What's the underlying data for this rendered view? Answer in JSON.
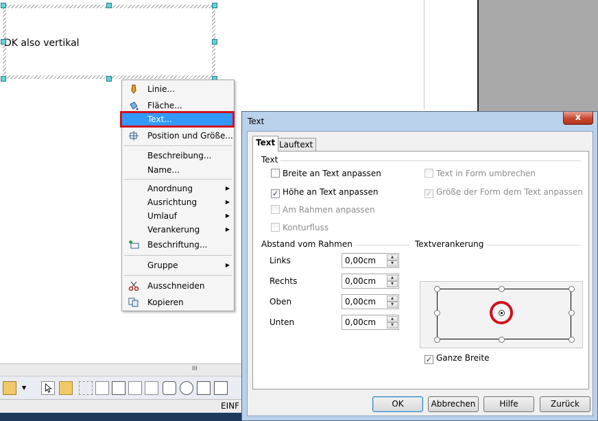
{
  "document": {
    "frame_text": "DK also vertikal"
  },
  "context_menu": {
    "items": [
      {
        "label": "Linie..."
      },
      {
        "label": "Fläche..."
      },
      {
        "label": "Text..."
      },
      {
        "label": "Position und Größe..."
      },
      {
        "label": "Beschreibung..."
      },
      {
        "label": "Name..."
      },
      {
        "label": "Anordnung"
      },
      {
        "label": "Ausrichtung"
      },
      {
        "label": "Umlauf"
      },
      {
        "label": "Verankerung"
      },
      {
        "label": "Beschriftung..."
      },
      {
        "label": "Gruppe"
      },
      {
        "label": "Ausschneiden"
      },
      {
        "label": "Kopieren"
      }
    ],
    "highlight_color": "#3399ff",
    "callout_color": "#d0101c"
  },
  "toolbar": {
    "grip": "III"
  },
  "statusbar": {
    "mode": "EINF"
  },
  "dialog": {
    "title": "Text",
    "close_label": "x",
    "tabs": [
      {
        "label": "Text",
        "active": true
      },
      {
        "label": "Lauftext",
        "active": false
      }
    ],
    "text_group": {
      "label": "Text",
      "options": [
        {
          "label": "Breite an Text anpassen",
          "checked": false,
          "enabled": true
        },
        {
          "label": "Höhe an Text anpassen",
          "checked": true,
          "enabled": true
        },
        {
          "label": "Am Rahmen anpassen",
          "checked": false,
          "enabled": false
        },
        {
          "label": "Konturfluss",
          "checked": false,
          "enabled": false
        },
        {
          "label": "Text in Form umbrechen",
          "checked": false,
          "enabled": false
        },
        {
          "label": "Größe der Form dem Text anpassen",
          "checked": true,
          "enabled": false
        }
      ]
    },
    "spacing_group": {
      "label": "Abstand vom Rahmen",
      "fields": [
        {
          "label": "Links",
          "value": "0,00cm"
        },
        {
          "label": "Rechts",
          "value": "0,00cm"
        },
        {
          "label": "Oben",
          "value": "0,00cm"
        },
        {
          "label": "Unten",
          "value": "0,00cm"
        }
      ]
    },
    "anchor_group": {
      "label": "Textverankerung",
      "selected": "center",
      "full_width_label": "Ganze Breite",
      "full_width_checked": true
    },
    "buttons": {
      "ok": "OK",
      "cancel": "Abbrechen",
      "help": "Hilfe",
      "reset": "Zurück"
    }
  }
}
